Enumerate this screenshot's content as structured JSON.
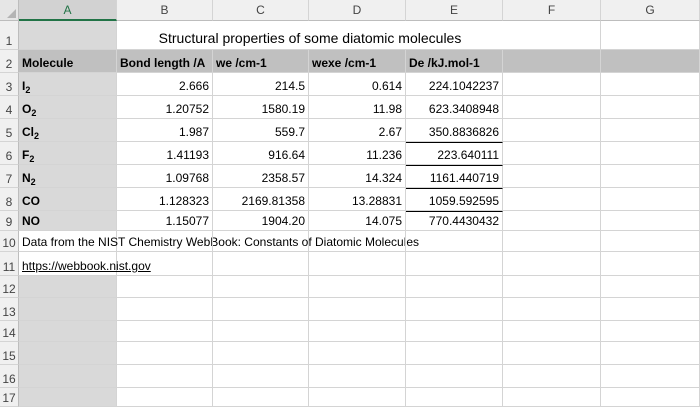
{
  "columns": [
    "A",
    "B",
    "C",
    "D",
    "E",
    "F",
    "G"
  ],
  "rows": [
    "1",
    "2",
    "3",
    "4",
    "5",
    "6",
    "7",
    "8",
    "9",
    "10",
    "11",
    "12",
    "13",
    "14",
    "15",
    "16",
    "17"
  ],
  "title": "Structural properties of some diatomic molecules",
  "headers": {
    "molecule": "Molecule",
    "bond_length": "Bond length /A",
    "we": "we /cm-1",
    "wexe": "wexe /cm-1",
    "de": "De /kJ.mol-1"
  },
  "molecules": [
    {
      "symbol": "I",
      "sub": "2",
      "bond": "2.666",
      "we": "214.5",
      "wexe": "0.614",
      "de": "224.1042237"
    },
    {
      "symbol": "O",
      "sub": "2",
      "bond": "1.20752",
      "we": "1580.19",
      "wexe": "11.98",
      "de": "623.3408948"
    },
    {
      "symbol": "Cl",
      "sub": "2",
      "bond": "1.987",
      "we": "559.7",
      "wexe": "2.67",
      "de": "350.8836826"
    },
    {
      "symbol": "F",
      "sub": "2",
      "bond": "1.41193",
      "we": "916.64",
      "wexe": "11.236",
      "de": "223.640111"
    },
    {
      "symbol": "N",
      "sub": "2",
      "bond": "1.09768",
      "we": "2358.57",
      "wexe": "14.324",
      "de": "1161.440719"
    },
    {
      "symbol": "CO",
      "sub": "",
      "bond": "1.128323",
      "we": "2169.81358",
      "wexe": "13.28831",
      "de": "1059.592595"
    },
    {
      "symbol": "NO",
      "sub": "",
      "bond": "1.15077",
      "we": "1904.20",
      "wexe": "14.075",
      "de": "770.4430432"
    }
  ],
  "source_note": "Data from the NIST Chemistry WebBook: Constants of Diatomic Molecules",
  "source_link": "https://webbook.nist.gov",
  "colors": {
    "selected_col": "#217346",
    "header_fill": "#c0c0c0",
    "col_a_fill": "#d9d9d9"
  }
}
